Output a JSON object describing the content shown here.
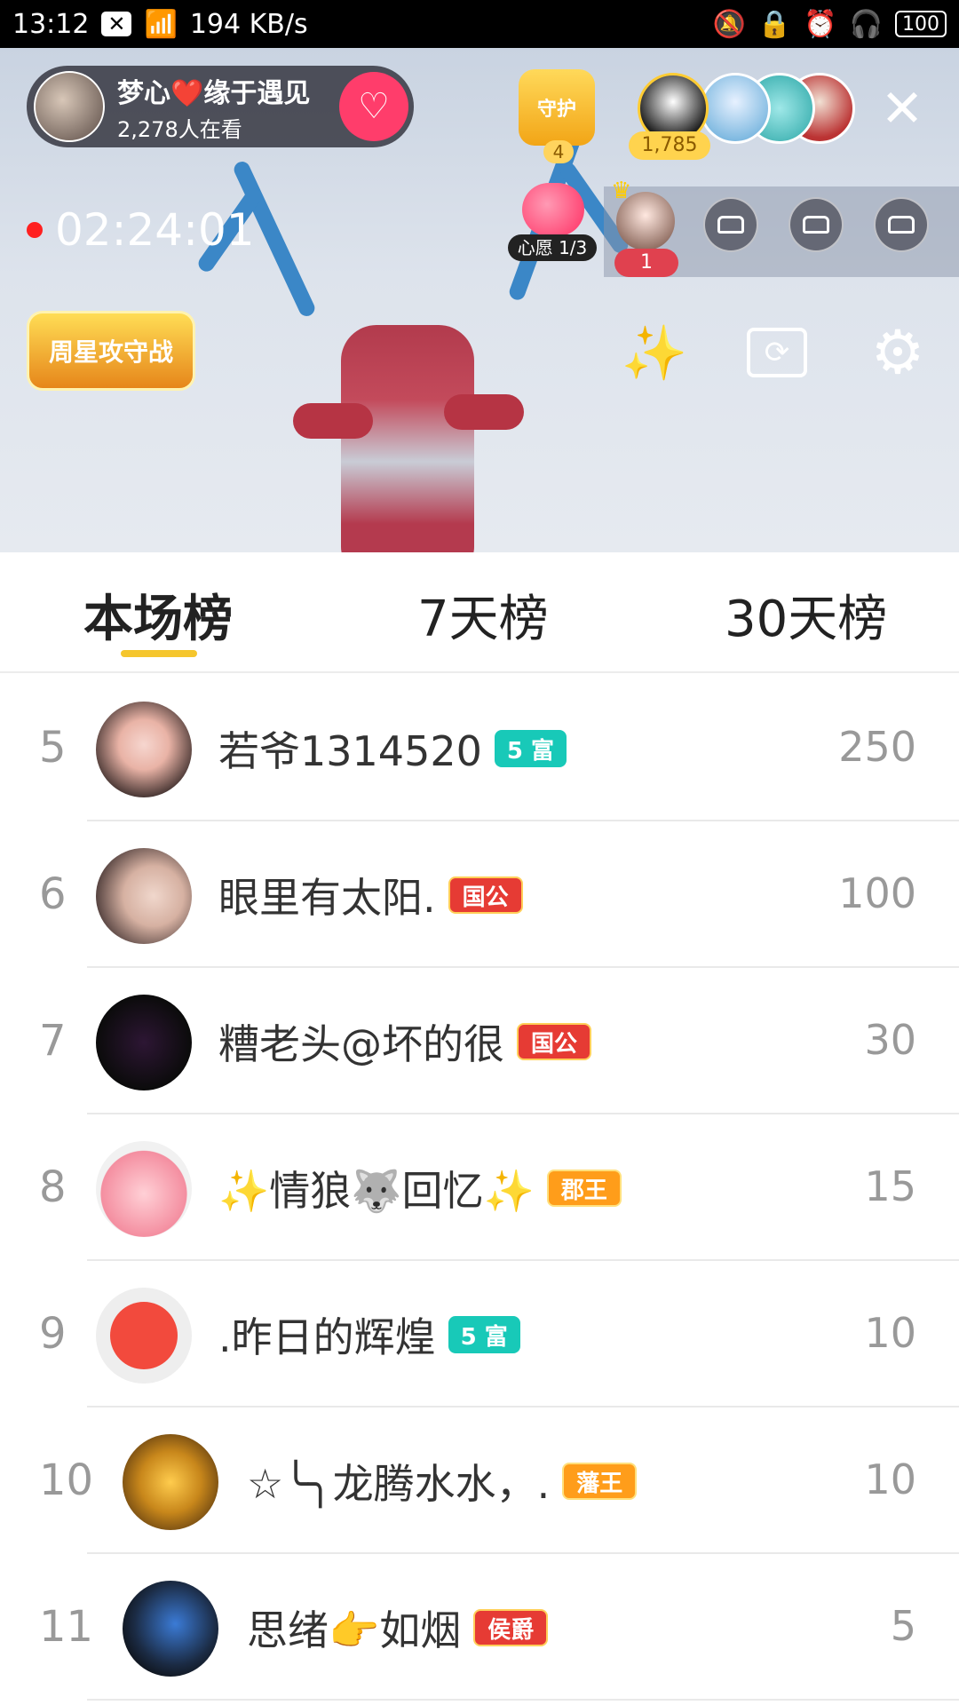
{
  "statusbar": {
    "time": "13:12",
    "net_speed": "194 KB/s",
    "battery": "100"
  },
  "live": {
    "host_name": "梦心❤️缘于遇见",
    "viewers": "2,278人在看",
    "guard_label": "守护",
    "guard_count": "4",
    "audience_count": "1,785",
    "timer": "02:24:01",
    "wish_label": "心愿 1/3",
    "seat_rank": "1",
    "event_badge": "周星攻守战"
  },
  "tabs": [
    {
      "label": "本场榜"
    },
    {
      "label": "7天榜"
    },
    {
      "label": "30天榜"
    }
  ],
  "ranking": [
    {
      "rank": "5",
      "name": "若爷1314520",
      "badge": "5 富",
      "badge_type": "rich",
      "score": "250"
    },
    {
      "rank": "6",
      "name": "眼里有太阳.",
      "badge": "国公",
      "badge_type": "duke",
      "score": "100"
    },
    {
      "rank": "7",
      "name": "糟老头@坏的很",
      "badge": "国公",
      "badge_type": "duke",
      "score": "30"
    },
    {
      "rank": "8",
      "name": "✨情狼🐺回忆✨",
      "badge": "郡王",
      "badge_type": "king",
      "score": "15"
    },
    {
      "rank": "9",
      "name": ".昨日的辉煌",
      "badge": "5 富",
      "badge_type": "rich",
      "score": "10"
    },
    {
      "rank": "10",
      "name": "☆╰╮龙腾水水，.",
      "badge": "藩王",
      "badge_type": "king",
      "score": "10"
    },
    {
      "rank": "11",
      "name": "思绪👉如烟",
      "badge": "侯爵",
      "badge_type": "duke",
      "score": "5"
    }
  ],
  "icons": {
    "close": "close-icon",
    "follow": "heart-plus-icon",
    "magic": "magic-wand-icon",
    "camera": "camera-switch-icon",
    "settings": "gear-icon",
    "seat": "sofa-icon"
  }
}
